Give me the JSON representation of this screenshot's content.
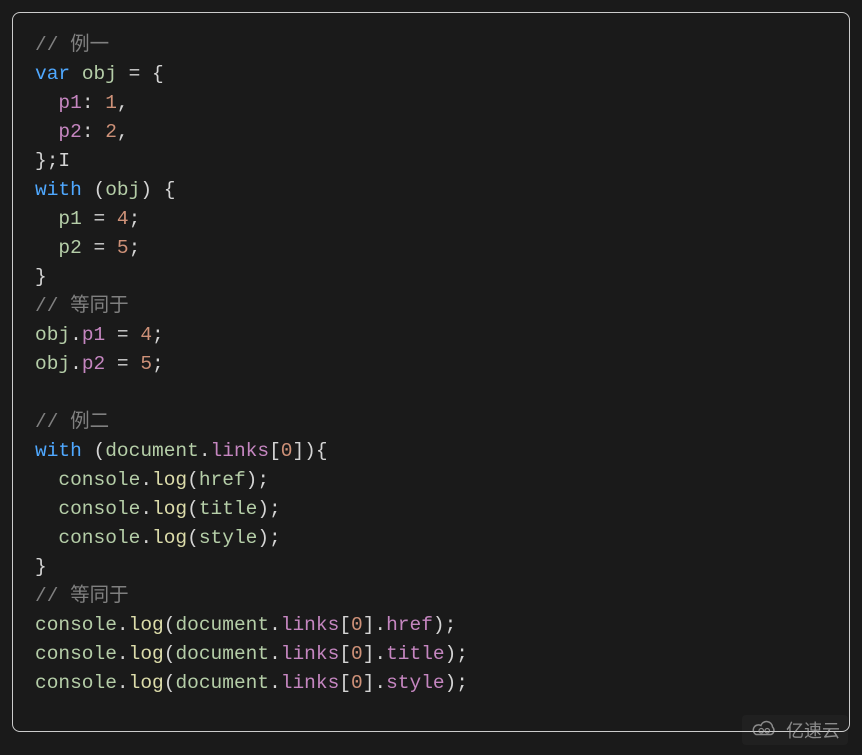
{
  "code": {
    "c1": "// 例一",
    "c2": "// 等同于",
    "c3": "// 例二",
    "c4": "// 等同于",
    "kw_var": "var",
    "kw_with": "with",
    "obj": "obj",
    "p1": "p1",
    "p2": "p2",
    "n1": "1",
    "n2": "2",
    "n4": "4",
    "n5": "5",
    "n0": "0",
    "console": "console",
    "log": "log",
    "document": "document",
    "links": "links",
    "href": "href",
    "title": "title",
    "style": "style"
  },
  "watermark": {
    "text": "亿速云"
  }
}
